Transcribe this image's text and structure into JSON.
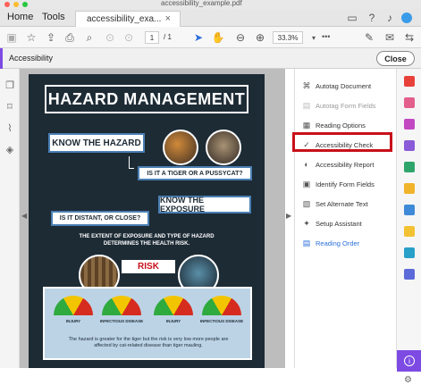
{
  "window": {
    "title": "accessibility_example.pdf"
  },
  "menu": {
    "home": "Home",
    "tools": "Tools"
  },
  "tab": {
    "label": "accessibility_exa...",
    "close": "×"
  },
  "toolbar": {
    "page_current": "1",
    "page_total": "/ 1",
    "zoom": "33.3%",
    "more": "•••"
  },
  "accessibility_bar": {
    "label": "Accessibility",
    "close": "Close"
  },
  "right_panel": {
    "items": [
      {
        "label": "Autotag Document",
        "icon": "autotag-icon",
        "state": "normal"
      },
      {
        "label": "Autotag Form Fields",
        "icon": "form-autotag-icon",
        "state": "disabled"
      },
      {
        "label": "Reading Options",
        "icon": "reading-options-icon",
        "state": "normal"
      },
      {
        "label": "Accessibility Check",
        "icon": "check-circle-icon",
        "state": "highlighted"
      },
      {
        "label": "Accessibility Report",
        "icon": "report-icon",
        "state": "normal"
      },
      {
        "label": "Identify Form Fields",
        "icon": "form-fields-icon",
        "state": "normal"
      },
      {
        "label": "Set Alternate Text",
        "icon": "alt-text-icon",
        "state": "normal"
      },
      {
        "label": "Setup Assistant",
        "icon": "wand-icon",
        "state": "normal"
      },
      {
        "label": "Reading Order",
        "icon": "reading-order-icon",
        "state": "link"
      }
    ]
  },
  "poster": {
    "title": "HAZARD MANAGEMENT",
    "know_hazard": "KNOW THE HAZARD",
    "question1": "IS IT A TIGER OR A PUSSYCAT?",
    "know_exposure": "KNOW THE EXPOSURE",
    "question2": "IS IT DISTANT, OR CLOSE?",
    "extent": "THE EXTENT OF EXPOSURE AND TYPE OF HAZARD DETERMINES THE HEALTH RISK.",
    "risk": "RISK",
    "gauge_labels": [
      "INJURY",
      "INFECTIOUS DISEASE",
      "INJURY",
      "INFECTIOUS DISEASE"
    ],
    "footer": "The hazard is greater for the tiger but the risk is very low more people are affected by cat-related disease than tiger mauling."
  },
  "colors": {
    "accent": "#7d4be3",
    "highlight": "#c8101a",
    "poster_bg": "#1d2b35",
    "link": "#2a6fdb"
  }
}
